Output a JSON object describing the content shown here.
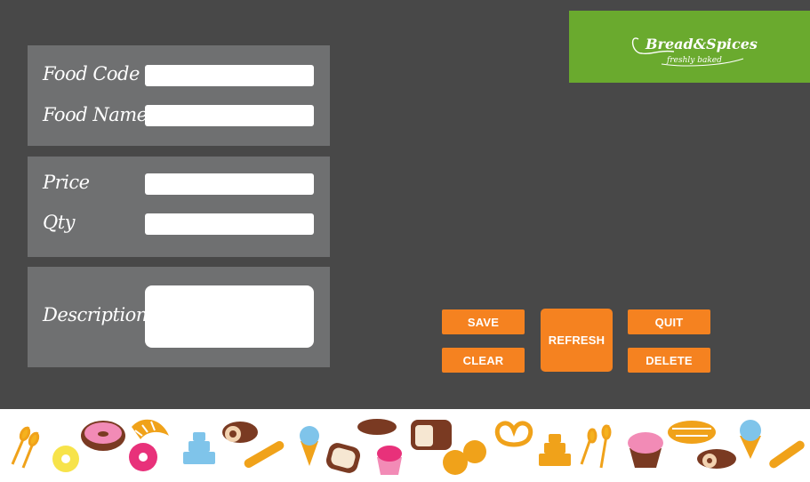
{
  "brand": {
    "name": "Bread&Spices",
    "tagline": "freshly baked",
    "color": "#6aaa2e"
  },
  "form": {
    "food_code": {
      "label": "Food Code",
      "value": ""
    },
    "food_name": {
      "label": "Food Name",
      "value": ""
    },
    "price": {
      "label": "Price",
      "value": ""
    },
    "qty": {
      "label": "Qty",
      "value": ""
    },
    "descriptions": {
      "label": "Descriptions",
      "value": ""
    }
  },
  "buttons": {
    "save": "SAVE",
    "clear": "CLEAR",
    "refresh": "REFRESH",
    "quit": "QUIT",
    "delete": "DELETE",
    "color": "#f58220"
  },
  "footer_icons": [
    "wheat-icon",
    "donut-icon",
    "croissant-icon",
    "donut-icon",
    "cake-icon",
    "roll-cake-icon",
    "baguette-icon",
    "ice-cream-icon",
    "toast-icon",
    "cupcake-icon",
    "bread-loaf-icon",
    "bread-slice-icon",
    "buns-icon",
    "pretzel-icon",
    "cake-icon",
    "wheat-icon",
    "muffin-icon",
    "pie-icon",
    "roll-cake-icon",
    "ice-cream-icon",
    "baguette-icon"
  ],
  "theme": {
    "background": "#484848",
    "panel": "#6f7071"
  }
}
